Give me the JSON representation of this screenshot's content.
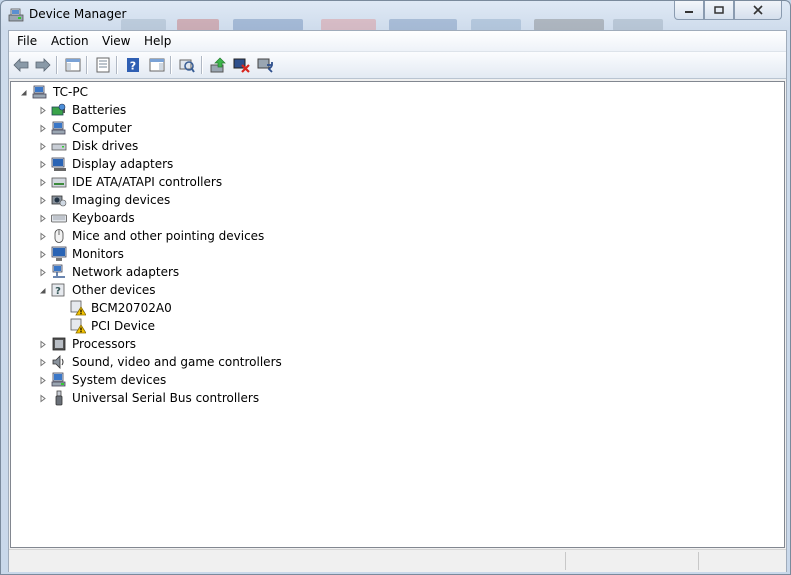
{
  "window": {
    "title": "Device Manager"
  },
  "menu": [
    {
      "label": "File",
      "name": "menu-file"
    },
    {
      "label": "Action",
      "name": "menu-action"
    },
    {
      "label": "View",
      "name": "menu-view"
    },
    {
      "label": "Help",
      "name": "menu-help"
    }
  ],
  "toolbar": [
    {
      "icon": "back-arrow-icon"
    },
    {
      "icon": "forward-arrow-icon"
    },
    {
      "icon": "show-hide-console-tree-icon"
    },
    {
      "icon": "properties-icon"
    },
    {
      "icon": "help-icon"
    },
    {
      "icon": "show-hide-action-pane-icon"
    },
    {
      "icon": "scan-hardware-changes-icon"
    },
    {
      "icon": "update-driver-icon"
    },
    {
      "icon": "uninstall-device-icon"
    },
    {
      "icon": "enable-device-icon"
    }
  ],
  "tree": {
    "root": {
      "label": "TC-PC",
      "icon": "computer-icon",
      "expanded": true
    },
    "items": [
      {
        "label": "Batteries",
        "icon": "battery-icon",
        "expanded": false
      },
      {
        "label": "Computer",
        "icon": "computer-icon",
        "expanded": false
      },
      {
        "label": "Disk drives",
        "icon": "disk-drive-icon",
        "expanded": false
      },
      {
        "label": "Display adapters",
        "icon": "display-adapter-icon",
        "expanded": false
      },
      {
        "label": "IDE ATA/ATAPI controllers",
        "icon": "ide-controller-icon",
        "expanded": false
      },
      {
        "label": "Imaging devices",
        "icon": "imaging-device-icon",
        "expanded": false
      },
      {
        "label": "Keyboards",
        "icon": "keyboard-icon",
        "expanded": false
      },
      {
        "label": "Mice and other pointing devices",
        "icon": "mouse-icon",
        "expanded": false
      },
      {
        "label": "Monitors",
        "icon": "monitor-icon",
        "expanded": false
      },
      {
        "label": "Network adapters",
        "icon": "network-adapter-icon",
        "expanded": false
      },
      {
        "label": "Other devices",
        "icon": "other-devices-icon",
        "expanded": true,
        "children": [
          {
            "label": "BCM20702A0",
            "icon": "unknown-device-warning-icon"
          },
          {
            "label": "PCI Device",
            "icon": "unknown-device-warning-icon"
          }
        ]
      },
      {
        "label": "Processors",
        "icon": "processor-icon",
        "expanded": false
      },
      {
        "label": "Sound, video and game controllers",
        "icon": "sound-icon",
        "expanded": false
      },
      {
        "label": "System devices",
        "icon": "system-device-icon",
        "expanded": false
      },
      {
        "label": "Universal Serial Bus controllers",
        "icon": "usb-icon",
        "expanded": false
      }
    ]
  },
  "colors": {
    "window_frame": "#c9d8ea",
    "tree_background": "#ffffff",
    "warning": "#f5c400"
  }
}
